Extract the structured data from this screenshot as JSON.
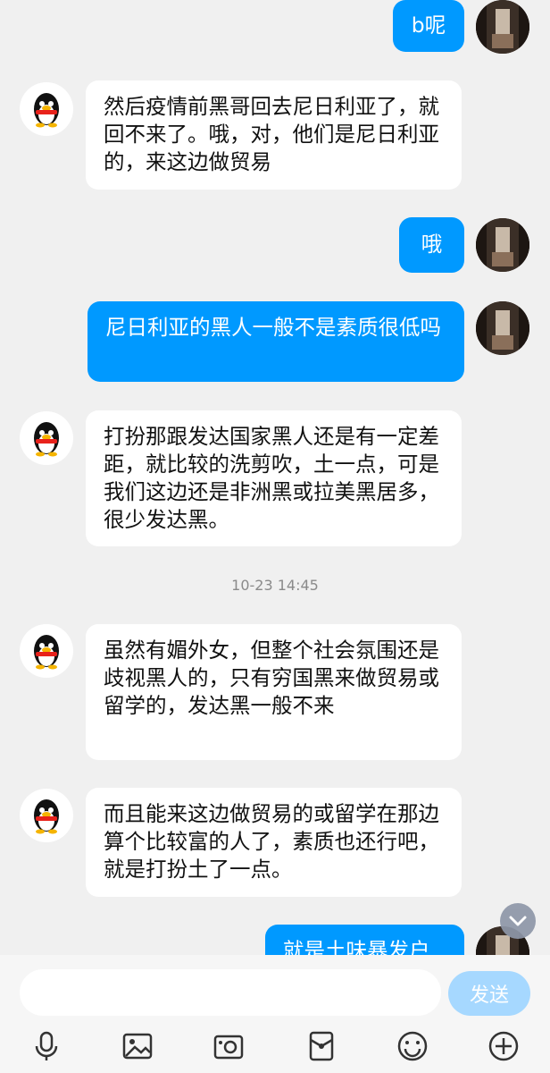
{
  "messages": [
    {
      "side": "out",
      "text": "b呢"
    },
    {
      "side": "in",
      "text": "然后疫情前黑哥回去尼日利亚了，就回不来了。哦，对，他们是尼日利亚的，来这边做贸易"
    },
    {
      "side": "out",
      "text": "哦"
    },
    {
      "side": "out",
      "text": "尼日利亚的黑人一般不是素质很低吗"
    },
    {
      "side": "in",
      "text": "打扮那跟发达国家黑人还是有一定差距，就比较的洗剪吹，土一点，可是我们这边还是非洲黑或拉美黑居多，很少发达黑。"
    },
    {
      "side": "in",
      "text": "虽然有媚外女，但整个社会氛围还是歧视黑人的，只有穷国黑来做贸易或留学的，发达黑一般不来"
    },
    {
      "side": "in",
      "text": "而且能来这边做贸易的或留学在那边算个比较富的人了，素质也还行吧，就是打扮土了一点。"
    },
    {
      "side": "out",
      "text": "就是土味暴发户"
    }
  ],
  "timestamp": "10-23 14:45",
  "input": {
    "placeholder": "",
    "value": ""
  },
  "send_label": "发送",
  "colors": {
    "background": "#f0f0f0",
    "bubble_in": "#ffffff",
    "bubble_out": "#0099ff",
    "send_button": "#a6d8ff",
    "icon": "#333333"
  },
  "toolbar": [
    "mic-icon",
    "image-icon",
    "camera-icon",
    "red-packet-icon",
    "emoji-icon",
    "plus-icon"
  ]
}
